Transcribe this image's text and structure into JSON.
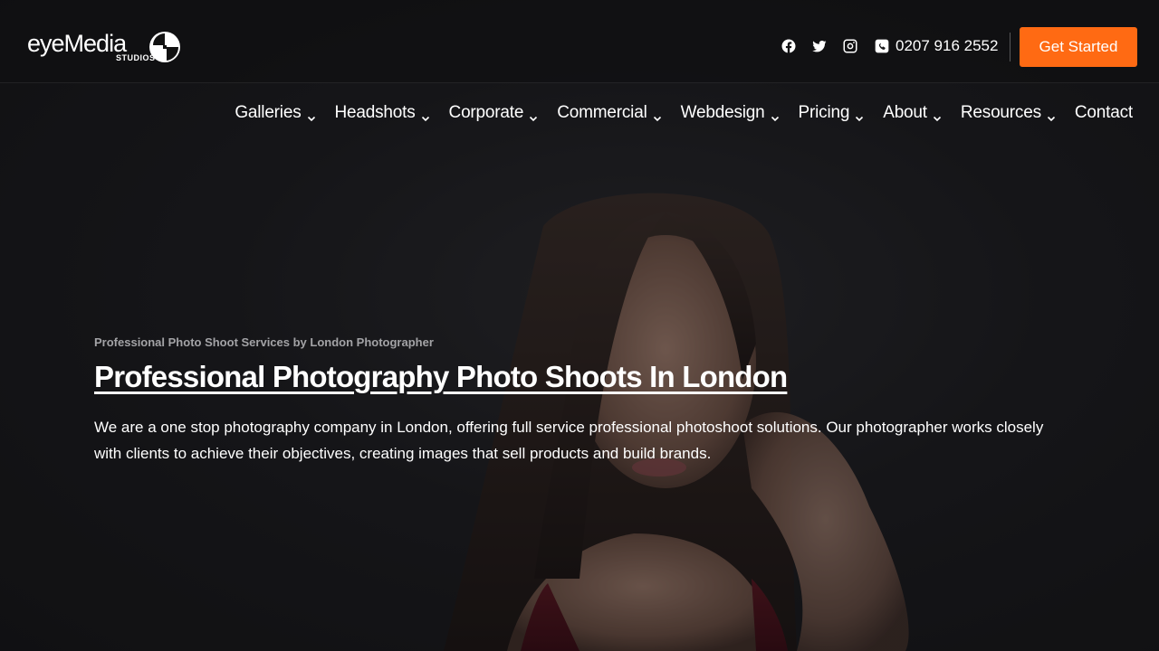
{
  "brand": {
    "name_part1": "eye",
    "name_part2": "Media",
    "sub": "STUDIOS"
  },
  "header": {
    "social_icons": [
      "facebook-icon",
      "twitter-icon",
      "instagram-icon"
    ],
    "phone": "0207 916 2552",
    "cta_label": "Get Started"
  },
  "nav": {
    "items": [
      {
        "label": "Galleries",
        "has_dropdown": true
      },
      {
        "label": "Headshots",
        "has_dropdown": true
      },
      {
        "label": "Corporate",
        "has_dropdown": true
      },
      {
        "label": "Commercial",
        "has_dropdown": true
      },
      {
        "label": "Webdesign",
        "has_dropdown": true
      },
      {
        "label": "Pricing",
        "has_dropdown": true
      },
      {
        "label": "About",
        "has_dropdown": true
      },
      {
        "label": "Resources",
        "has_dropdown": true
      },
      {
        "label": "Contact",
        "has_dropdown": false
      }
    ]
  },
  "hero": {
    "eyebrow": "Professional Photo Shoot Services by London Photographer",
    "title": "Professional Photography Photo Shoots In London",
    "body": "We are a one stop photography company in London, offering full service professional photoshoot solutions. Our photographer works closely with clients to achieve their objectives, creating images that sell products and build brands."
  },
  "colors": {
    "accent": "#ff6a13",
    "background": "#1a1a1c",
    "eyebrow": "#a3a3a6"
  }
}
